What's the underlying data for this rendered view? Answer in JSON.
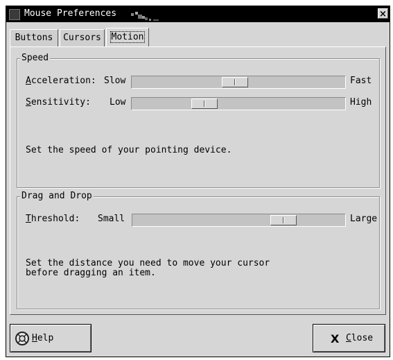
{
  "window": {
    "title": "Mouse Preferences",
    "close_symbol": "×"
  },
  "tabs": [
    {
      "label": "Buttons",
      "active": false
    },
    {
      "label": "Cursors",
      "active": false
    },
    {
      "label": "Motion",
      "active": true
    }
  ],
  "speed": {
    "legend": "Speed",
    "acceleration": {
      "mnemonic": "A",
      "rest": "cceleration:",
      "min_label": "Slow",
      "max_label": "Fast",
      "value": 0.48
    },
    "sensitivity": {
      "mnemonic": "S",
      "rest": "ensitivity:",
      "min_label": "Low",
      "max_label": "High",
      "value": 0.32
    },
    "description": "Set the speed of your pointing device."
  },
  "drag": {
    "legend": "Drag and Drop",
    "threshold": {
      "mnemonic": "T",
      "rest": "hreshold:",
      "min_label": "Small",
      "max_label": "Large",
      "value": 0.74
    },
    "description_line1": "Set the distance you need to move your cursor",
    "description_line2": "before dragging an item."
  },
  "buttons": {
    "help": {
      "mnemonic": "H",
      "rest": "elp",
      "icon": "lifebuoy-icon"
    },
    "close": {
      "mnemonic": "C",
      "rest": "lose",
      "icon": "x-icon",
      "symbol": "X"
    }
  }
}
